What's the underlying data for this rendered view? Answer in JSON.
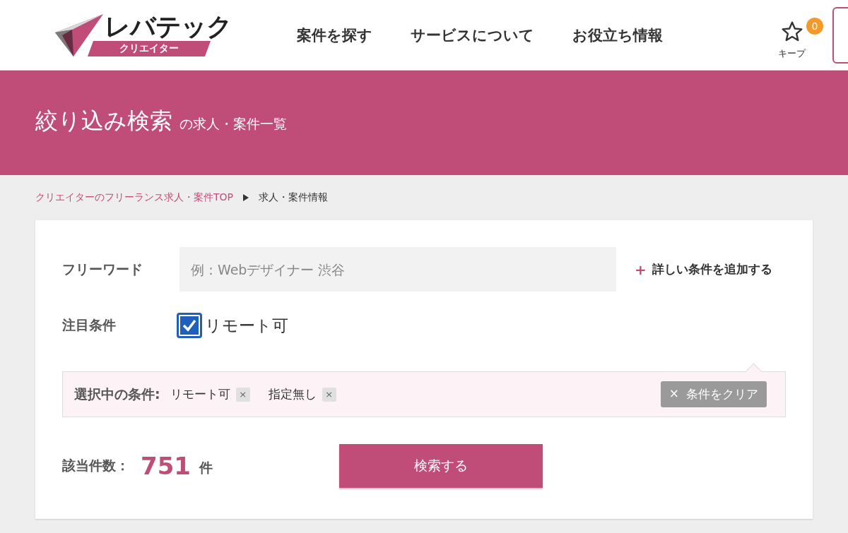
{
  "header": {
    "logo": {
      "name": "レバテック",
      "sub": "クリエイター"
    },
    "nav": [
      "案件を探す",
      "サービスについて",
      "お役立ち情報"
    ],
    "keep": {
      "label": "キープ",
      "count": "0"
    }
  },
  "banner": {
    "title": "絞り込み検索",
    "suffix": "の求人・案件一覧"
  },
  "breadcrumb": [
    {
      "label": "クリエイターのフリーランス求人・案件TOP",
      "link": true
    },
    {
      "label": "求人・案件情報",
      "link": false
    }
  ],
  "search": {
    "freeword_label": "フリーワード",
    "placeholder": "例：Webデザイナー 渋谷",
    "add_icon": "+",
    "add_label": "詳しい条件を追加する",
    "focus_label": "注目条件",
    "focus_options": [
      {
        "label": "リモート可",
        "checked": true
      }
    ],
    "selected_label": "選択中の条件:",
    "chips": [
      {
        "label": "リモート可",
        "remove": "×"
      },
      {
        "label": "指定無し",
        "remove": "×"
      }
    ],
    "clear_icon": "×",
    "clear_label": "条件をクリア",
    "count_label": "該当件数：",
    "count": "751",
    "count_unit": "件",
    "submit": "検索する"
  }
}
